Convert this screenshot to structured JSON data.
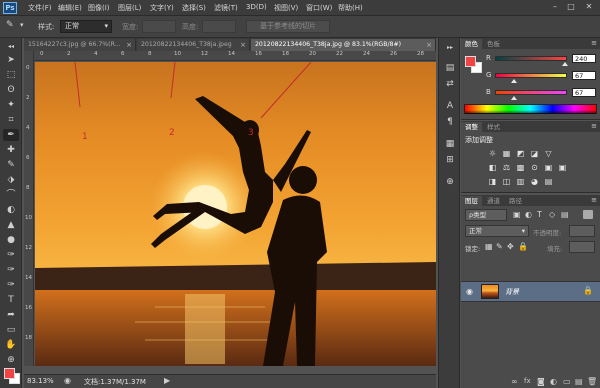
{
  "app": {
    "logo": "Ps",
    "menu": [
      "文件(F)",
      "编辑(E)",
      "图像(I)",
      "图层(L)",
      "文字(Y)",
      "选择(S)",
      "滤镜(T)",
      "3D(D)",
      "视图(V)",
      "窗口(W)",
      "帮助(H)"
    ],
    "window_controls": {
      "minimize": "–",
      "restore": "□",
      "close": "✕"
    }
  },
  "options_bar": {
    "style_label": "样式:",
    "style_value": "正常",
    "width_label": "宽度:",
    "height_label": "高度:",
    "slice_button": "基于参考线的切片"
  },
  "tabs": [
    {
      "label": "15164227c3.jpg @ 66.7%(R...",
      "active": false
    },
    {
      "label": "20120822134406_T38ja.jpeg",
      "active": false
    },
    {
      "label": "20120822134406_T38ja.jpg @ 83.1%(RGB/8#)",
      "active": true
    }
  ],
  "ruler": {
    "top_numbers": [
      "0",
      "2",
      "4",
      "6",
      "8",
      "10",
      "12",
      "14",
      "16",
      "18",
      "20",
      "22",
      "24",
      "26",
      "28"
    ],
    "left_numbers": [
      "0",
      "2",
      "4",
      "6",
      "8",
      "10",
      "12",
      "14",
      "16",
      "18"
    ]
  },
  "canvas": {
    "annotations": [
      "1",
      "2",
      "3"
    ]
  },
  "status": {
    "zoom": "83.13%",
    "doc": "文档:1.37M/1.37M",
    "arrow": "▶"
  },
  "color_panel": {
    "tabs": [
      "颜色",
      "色板"
    ],
    "channels": [
      {
        "label": "R",
        "value": "240"
      },
      {
        "label": "G",
        "value": "67"
      },
      {
        "label": "B",
        "value": "67"
      }
    ],
    "foreground": "#f04343",
    "background": "#ffffff",
    "menu_icon": "≡"
  },
  "adjust_panel": {
    "tabs": [
      "调整",
      "样式"
    ],
    "title": "添加调整",
    "row1": [
      "☼",
      "▦",
      "◩",
      "◪",
      "▽"
    ],
    "row2": [
      "◧",
      "⚖",
      "▩",
      "⊙",
      "▣"
    ],
    "row3": [
      "◨",
      "◫",
      "▥",
      "◕",
      "▤"
    ]
  },
  "layers_panel": {
    "tabs": [
      "图层",
      "通道",
      "路径"
    ],
    "kind_filter": "ρ类型",
    "filter_icons": [
      "▣",
      "◐",
      "T",
      "◇",
      "▤"
    ],
    "blend_mode": "正常",
    "opacity_label": "不透明度:",
    "lock_label": "锁定:",
    "lock_icons": [
      "▦",
      "✎",
      "✥",
      "🔒"
    ],
    "fill_label": "填充:",
    "layer_name": "背景",
    "footer_icons": [
      "∞",
      "fx",
      "◙",
      "◐",
      "▭",
      "▤",
      "🗑"
    ]
  },
  "tools": [
    "➤",
    "⬚",
    "ʘ",
    "✦",
    "⌗",
    "✒",
    "✚",
    "✎",
    "⬗",
    "⌒",
    "◐",
    "▲",
    "●",
    "✑",
    "T",
    "➦",
    "▭",
    "✋",
    "⊕"
  ],
  "middle_strip": [
    "▤",
    "⇄",
    "A",
    "¶",
    "▦",
    "⊞",
    "⊕"
  ]
}
